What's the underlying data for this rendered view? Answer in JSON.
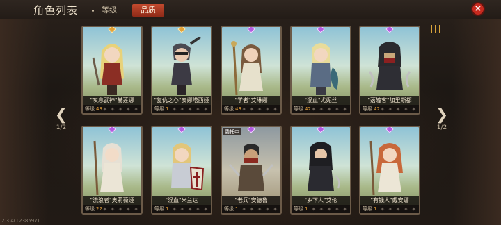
{
  "header": {
    "title": "角色列表",
    "tabs": [
      {
        "label": "等级"
      },
      {
        "label": "品质"
      }
    ],
    "close_label": "×"
  },
  "pager": {
    "left": {
      "icon": "left-arrow-icon",
      "text": "1/2"
    },
    "right": {
      "icon": "right-arrow-icon",
      "text": "1/2"
    }
  },
  "version": "2.3.4(1238597)",
  "level_label": "等级",
  "cards": [
    {
      "name": "\"叹息武神\"赫莲娜",
      "level": "43",
      "gem": "gold",
      "stars": "✦ ✦ ✦ ✦ ✦"
    },
    {
      "name": "\"复仇之心\"安娜塔西娅",
      "level": "1",
      "gem": "gold",
      "stars": "✦ ✦ ✦ ✦ ✦"
    },
    {
      "name": "\"学者\"艾琳娜",
      "level": "43",
      "gem": "purple",
      "stars": "✦ ✦ ✦ ✦ ✦"
    },
    {
      "name": "\"混血\"尤妮丝",
      "level": "42",
      "gem": "purple",
      "stars": "✦ ✦ ✦ ✦ ✦"
    },
    {
      "name": "\"落魄客\"加里斯都",
      "level": "42",
      "gem": "purple",
      "stars": "✦ ✦ ✦ ✦ ✦"
    },
    {
      "name": "\"流浪者\"奥莉薇娅",
      "level": "22",
      "gem": "purple",
      "stars": "✦ ✦ ✦ ✦ ✦"
    },
    {
      "name": "\"混血\"米兰达",
      "level": "1",
      "gem": "purple",
      "stars": "✦ ✦ ✦ ✦ ✦"
    },
    {
      "name": "\"老兵\"安德鲁",
      "level": "1",
      "gem": "purple",
      "stars": "✦ ✦ ✦ ✦ ✦",
      "tag": "委托中"
    },
    {
      "name": "\"乡下人\"艾伦",
      "level": "1",
      "gem": "purple",
      "stars": "✦ ✦ ✦ ✦ ✦"
    },
    {
      "name": "\"有钱人\"戴安娜",
      "level": "1",
      "gem": "purple",
      "stars": "✦ ✦ ✦ ✦ ✦"
    }
  ]
}
